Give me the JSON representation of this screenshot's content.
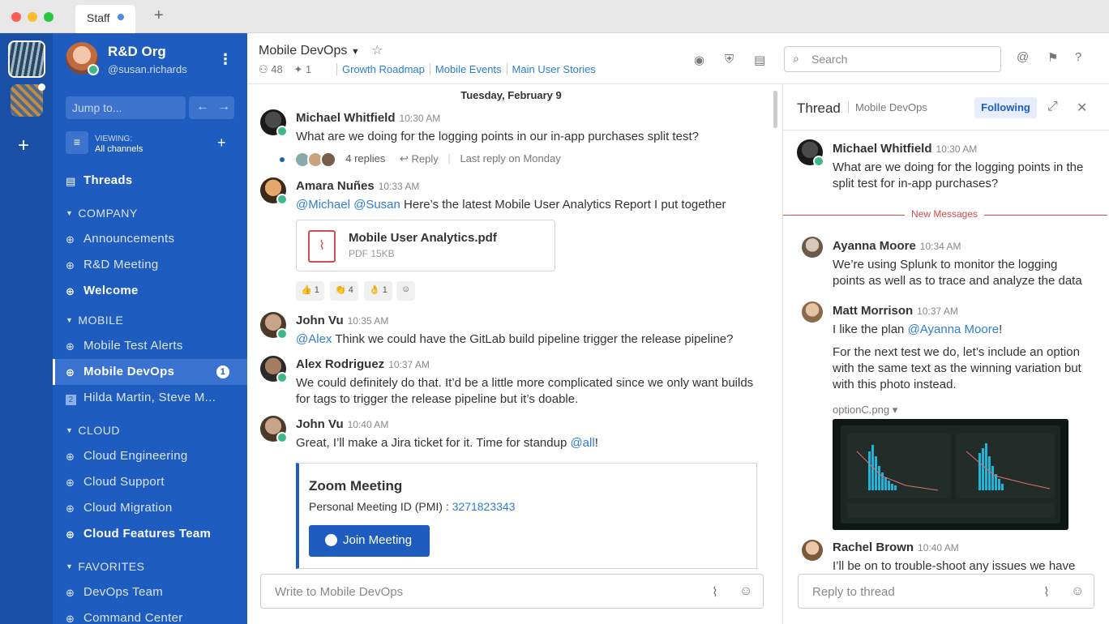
{
  "window": {
    "tab_title": "Staff",
    "new_tab": "+"
  },
  "org": {
    "name": "R&D Org",
    "handle": "@susan.richards"
  },
  "sidebar": {
    "jump_placeholder": "Jump to...",
    "viewing_label": "VIEWING:",
    "viewing_value": "All channels",
    "threads_label": "Threads",
    "sections": [
      {
        "title": "COMPANY",
        "items": [
          "Announcements",
          "R&D Meeting",
          "Welcome"
        ]
      },
      {
        "title": "MOBILE",
        "items": [
          "Mobile Test Alerts",
          "Mobile DevOps",
          "Hilda Martin, Steve M..."
        ]
      },
      {
        "title": "CLOUD",
        "items": [
          "Cloud Engineering",
          "Cloud Support",
          "Cloud Migration",
          "Cloud Features Team"
        ]
      },
      {
        "title": "FAVORITES",
        "items": [
          "DevOps Team",
          "Command Center"
        ]
      }
    ],
    "unread_badge": "1",
    "dm_count": "2"
  },
  "channel": {
    "name": "Mobile DevOps",
    "members": "48",
    "pinned": "1",
    "links": [
      "Growth Roadmap",
      "Mobile Events",
      "Main User Stories"
    ],
    "search_placeholder": "Search"
  },
  "messages": {
    "date_separator": "Tuesday, February 9",
    "m1": {
      "author": "Michael Whitfield",
      "time": "10:30 AM",
      "text": "What are we doing for the logging points in our in-app purchases split test?",
      "replies": "4 replies",
      "reply": "Reply",
      "last_reply": "Last reply on Monday"
    },
    "m2": {
      "author": "Amara Nuñes",
      "time": "10:33 AM",
      "mention1": "@Michael",
      "mention2": "@Susan",
      "text": " Here’s the latest Mobile User Analytics Report I put together",
      "file_name": "Mobile User Analytics.pdf",
      "file_meta": "PDF 15KB",
      "reactions": [
        "1",
        "4",
        "1"
      ]
    },
    "m3": {
      "author": "John Vu",
      "time": "10:35 AM",
      "mention": "@Alex",
      "text": " Think we could have the GitLab build pipeline trigger the release pipeline?"
    },
    "m4": {
      "author": "Alex Rodriguez",
      "time": "10:37 AM",
      "text": "We could definitely do that. It’d be a little more complicated since we only want builds for tags to trigger the release pipeline but it’s doable."
    },
    "m5": {
      "author": "John Vu",
      "time": "10:40 AM",
      "text": "Great, I’ll make a Jira ticket for it. Time for standup ",
      "mention": "@all",
      "suffix": "!"
    },
    "zoom": {
      "title": "Zoom Meeting",
      "id_label": "Personal Meeting ID (PMI) : ",
      "id_value": "3271823343",
      "button": "Join Meeting"
    },
    "composer_placeholder": "Write to Mobile DevOps"
  },
  "thread": {
    "title": "Thread",
    "channel": "Mobile DevOps",
    "following": "Following",
    "root": {
      "author": "Michael Whitfield",
      "time": "10:30 AM",
      "text": "What are we doing for the logging points in the split test for in-app purchases?"
    },
    "new_messages": "New Messages",
    "r1": {
      "author": "Ayanna Moore",
      "time": "10:34 AM",
      "text": "We’re using Splunk to monitor the logging points as well as to trace and analyze the data"
    },
    "r2": {
      "author": "Matt Morrison",
      "time": "10:37 AM",
      "text_a": "I like the plan ",
      "mention": "@Ayanna Moore",
      "text_b": "!",
      "text2": "For the next test we do, let’s include an option with the same text as the winning variation but with this photo instead.",
      "attachment": "optionC.png ▾"
    },
    "r3": {
      "author": "Rachel Brown",
      "time": "10:40 AM",
      "text": "I’ll be on to trouble-shoot any issues we have"
    },
    "composer_placeholder": "Reply to thread"
  },
  "colors": {
    "sidebar": "#1f5cc0",
    "team_bar": "#1a4fa6",
    "accent": "#2d7dd2",
    "online": "#3db887",
    "alert": "#d24b4e"
  }
}
